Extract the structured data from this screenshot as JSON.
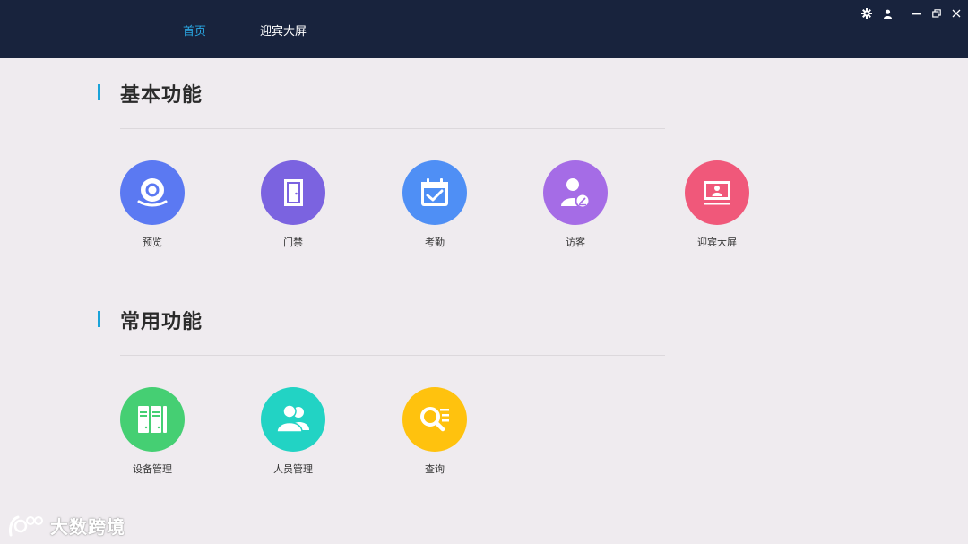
{
  "header": {
    "tabs": [
      {
        "label": "首页",
        "active": true
      },
      {
        "label": "迎宾大屏",
        "active": false
      }
    ],
    "controls": [
      "gear-icon",
      "user-icon",
      "minimize-icon",
      "restore-icon",
      "close-icon"
    ]
  },
  "sections": [
    {
      "title": "基本功能",
      "items": [
        {
          "label": "预览",
          "icon": "camera-icon",
          "color": "#5b79f2"
        },
        {
          "label": "门禁",
          "icon": "door-icon",
          "color": "#7b63e0"
        },
        {
          "label": "考勤",
          "icon": "calendar-check-icon",
          "color": "#4f8ff5"
        },
        {
          "label": "访客",
          "icon": "visitor-icon",
          "color": "#a56ce6"
        },
        {
          "label": "迎宾大屏",
          "icon": "welcome-screen-icon",
          "color": "#f0587a"
        }
      ]
    },
    {
      "title": "常用功能",
      "items": [
        {
          "label": "设备管理",
          "icon": "device-icon",
          "color": "#45cf73"
        },
        {
          "label": "人员管理",
          "icon": "people-icon",
          "color": "#22d3c4"
        },
        {
          "label": "查询",
          "icon": "search-list-icon",
          "color": "#ffc20e"
        }
      ]
    }
  ],
  "watermark": {
    "text": "大数跨境"
  },
  "colors": {
    "header_bg": "#18233d",
    "active_tab": "#2aa7e3",
    "accent": "#1aa3d9",
    "page_bg": "#efebef"
  }
}
